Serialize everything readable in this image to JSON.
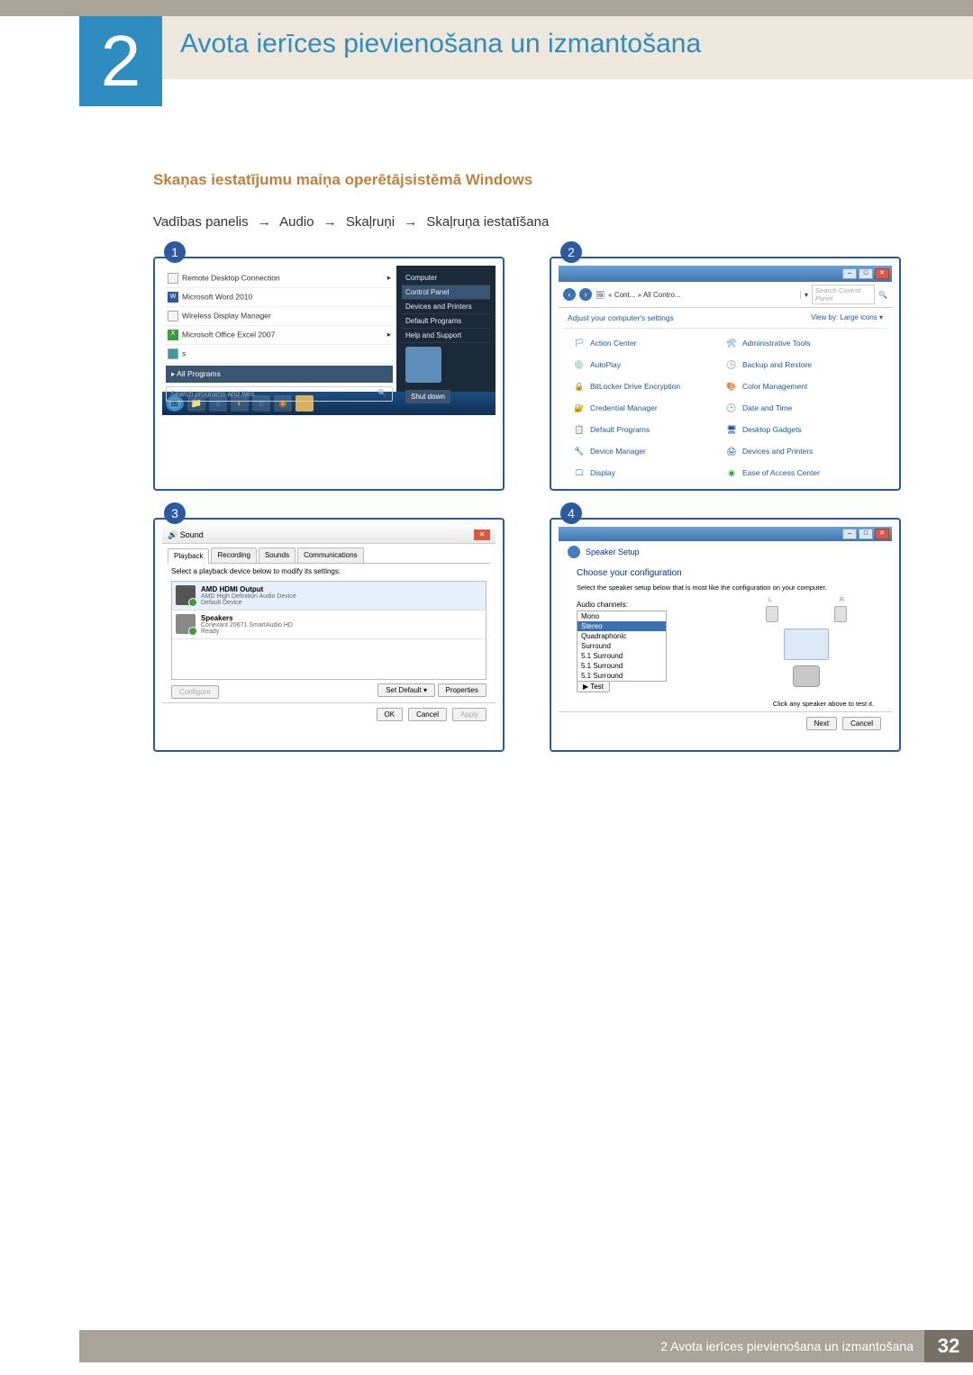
{
  "chapter": {
    "number": "2",
    "title": "Avota ierīces pievienošana un izmantošana"
  },
  "section": {
    "heading": "Skaņas iestatījumu maiņa operētājsistēmā Windows"
  },
  "breadcrumb": {
    "a": "Vadības panelis",
    "b": "Audio",
    "c": "Skaļruņi",
    "d": "Skaļruņa iestatīšana",
    "arrow": "→"
  },
  "panel1": {
    "num": "1",
    "apps": {
      "rdc": "Remote Desktop Connection",
      "word": "Microsoft Word 2010",
      "wdm": "Wireless Display Manager",
      "excel": "Microsoft Office Excel 2007",
      "s": "s"
    },
    "all_programs": "All Programs",
    "search_placeholder": "Search programs and files",
    "side": {
      "computer": "Computer",
      "control_panel": "Control Panel",
      "devices": "Devices and Printers",
      "default": "Default Programs",
      "help": "Help and Support"
    },
    "shutdown": "Shut down"
  },
  "panel2": {
    "num": "2",
    "addr_path": "« Cont... » All Contro...",
    "search_placeholder": "Search Control Panel",
    "adjust": "Adjust your computer's settings",
    "viewby": "View by:  Large icons ▾",
    "items": {
      "action_center": "Action Center",
      "admin": "Administrative Tools",
      "autoplay": "AutoPlay",
      "backup": "Backup and Restore",
      "bitlocker": "BitLocker Drive Encryption",
      "color": "Color Management",
      "cred": "Credential Manager",
      "date": "Date and Time",
      "defprog": "Default Programs",
      "gadgets": "Desktop Gadgets",
      "devmgr": "Device Manager",
      "devprn": "Devices and Printers",
      "display": "Display",
      "ease": "Ease of Access Center"
    }
  },
  "panel3": {
    "num": "3",
    "title": "Sound",
    "tabs": {
      "playback": "Playback",
      "recording": "Recording",
      "sounds": "Sounds",
      "comm": "Communications"
    },
    "hint": "Select a playback device below to modify its settings:",
    "dev1": {
      "t": "AMD HDMI Output",
      "s1": "AMD High Definition Audio Device",
      "s2": "Default Device"
    },
    "dev2": {
      "t": "Speakers",
      "s1": "Conexant 20671 SmartAudio HD",
      "s2": "Ready"
    },
    "btns": {
      "configure": "Configure",
      "set_default": "Set Default ▾",
      "properties": "Properties",
      "ok": "OK",
      "cancel": "Cancel",
      "apply": "Apply"
    }
  },
  "panel4": {
    "num": "4",
    "title": "Speaker Setup",
    "choose": "Choose your configuration",
    "desc": "Select the speaker setup below that is most like the configuration on your computer.",
    "audio_channels": "Audio channels:",
    "speaker_l": "L",
    "speaker_r": "R",
    "list": {
      "mono": "Mono",
      "stereo": "Stereo",
      "quad": "Quadraphonic",
      "surround": "Surround",
      "s51": "5.1 Surround",
      "s51b": "5.1 Surround",
      "s52": "5.1 Surround"
    },
    "test": "▶ Test",
    "click_hint": "Click any speaker above to test it.",
    "btns": {
      "next": "Next",
      "cancel": "Cancel"
    }
  },
  "footer": {
    "text": "2 Avota ierīces pievienošana un izmantošana",
    "page": "32"
  }
}
